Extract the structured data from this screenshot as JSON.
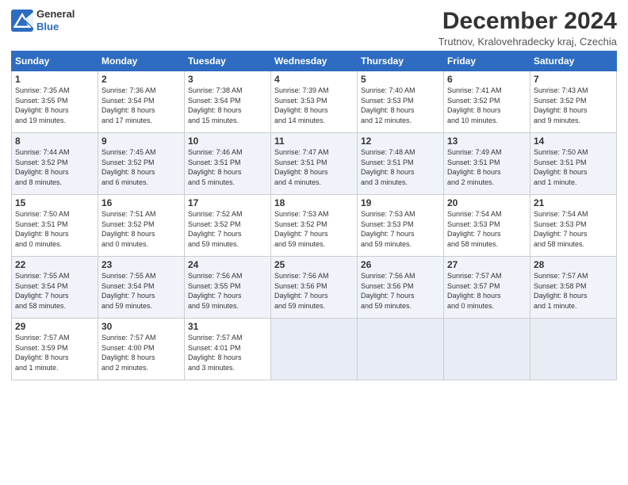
{
  "header": {
    "logo_line1": "General",
    "logo_line2": "Blue",
    "title": "December 2024",
    "location": "Trutnov, Kralovehradecky kraj, Czechia"
  },
  "days_of_week": [
    "Sunday",
    "Monday",
    "Tuesday",
    "Wednesday",
    "Thursday",
    "Friday",
    "Saturday"
  ],
  "weeks": [
    [
      {
        "day": "1",
        "info": "Sunrise: 7:35 AM\nSunset: 3:55 PM\nDaylight: 8 hours\nand 19 minutes."
      },
      {
        "day": "2",
        "info": "Sunrise: 7:36 AM\nSunset: 3:54 PM\nDaylight: 8 hours\nand 17 minutes."
      },
      {
        "day": "3",
        "info": "Sunrise: 7:38 AM\nSunset: 3:54 PM\nDaylight: 8 hours\nand 15 minutes."
      },
      {
        "day": "4",
        "info": "Sunrise: 7:39 AM\nSunset: 3:53 PM\nDaylight: 8 hours\nand 14 minutes."
      },
      {
        "day": "5",
        "info": "Sunrise: 7:40 AM\nSunset: 3:53 PM\nDaylight: 8 hours\nand 12 minutes."
      },
      {
        "day": "6",
        "info": "Sunrise: 7:41 AM\nSunset: 3:52 PM\nDaylight: 8 hours\nand 10 minutes."
      },
      {
        "day": "7",
        "info": "Sunrise: 7:43 AM\nSunset: 3:52 PM\nDaylight: 8 hours\nand 9 minutes."
      }
    ],
    [
      {
        "day": "8",
        "info": "Sunrise: 7:44 AM\nSunset: 3:52 PM\nDaylight: 8 hours\nand 8 minutes."
      },
      {
        "day": "9",
        "info": "Sunrise: 7:45 AM\nSunset: 3:52 PM\nDaylight: 8 hours\nand 6 minutes."
      },
      {
        "day": "10",
        "info": "Sunrise: 7:46 AM\nSunset: 3:51 PM\nDaylight: 8 hours\nand 5 minutes."
      },
      {
        "day": "11",
        "info": "Sunrise: 7:47 AM\nSunset: 3:51 PM\nDaylight: 8 hours\nand 4 minutes."
      },
      {
        "day": "12",
        "info": "Sunrise: 7:48 AM\nSunset: 3:51 PM\nDaylight: 8 hours\nand 3 minutes."
      },
      {
        "day": "13",
        "info": "Sunrise: 7:49 AM\nSunset: 3:51 PM\nDaylight: 8 hours\nand 2 minutes."
      },
      {
        "day": "14",
        "info": "Sunrise: 7:50 AM\nSunset: 3:51 PM\nDaylight: 8 hours\nand 1 minute."
      }
    ],
    [
      {
        "day": "15",
        "info": "Sunrise: 7:50 AM\nSunset: 3:51 PM\nDaylight: 8 hours\nand 0 minutes."
      },
      {
        "day": "16",
        "info": "Sunrise: 7:51 AM\nSunset: 3:52 PM\nDaylight: 8 hours\nand 0 minutes."
      },
      {
        "day": "17",
        "info": "Sunrise: 7:52 AM\nSunset: 3:52 PM\nDaylight: 7 hours\nand 59 minutes."
      },
      {
        "day": "18",
        "info": "Sunrise: 7:53 AM\nSunset: 3:52 PM\nDaylight: 7 hours\nand 59 minutes."
      },
      {
        "day": "19",
        "info": "Sunrise: 7:53 AM\nSunset: 3:53 PM\nDaylight: 7 hours\nand 59 minutes."
      },
      {
        "day": "20",
        "info": "Sunrise: 7:54 AM\nSunset: 3:53 PM\nDaylight: 7 hours\nand 58 minutes."
      },
      {
        "day": "21",
        "info": "Sunrise: 7:54 AM\nSunset: 3:53 PM\nDaylight: 7 hours\nand 58 minutes."
      }
    ],
    [
      {
        "day": "22",
        "info": "Sunrise: 7:55 AM\nSunset: 3:54 PM\nDaylight: 7 hours\nand 58 minutes."
      },
      {
        "day": "23",
        "info": "Sunrise: 7:55 AM\nSunset: 3:54 PM\nDaylight: 7 hours\nand 59 minutes."
      },
      {
        "day": "24",
        "info": "Sunrise: 7:56 AM\nSunset: 3:55 PM\nDaylight: 7 hours\nand 59 minutes."
      },
      {
        "day": "25",
        "info": "Sunrise: 7:56 AM\nSunset: 3:56 PM\nDaylight: 7 hours\nand 59 minutes."
      },
      {
        "day": "26",
        "info": "Sunrise: 7:56 AM\nSunset: 3:56 PM\nDaylight: 7 hours\nand 59 minutes."
      },
      {
        "day": "27",
        "info": "Sunrise: 7:57 AM\nSunset: 3:57 PM\nDaylight: 8 hours\nand 0 minutes."
      },
      {
        "day": "28",
        "info": "Sunrise: 7:57 AM\nSunset: 3:58 PM\nDaylight: 8 hours\nand 1 minute."
      }
    ],
    [
      {
        "day": "29",
        "info": "Sunrise: 7:57 AM\nSunset: 3:59 PM\nDaylight: 8 hours\nand 1 minute."
      },
      {
        "day": "30",
        "info": "Sunrise: 7:57 AM\nSunset: 4:00 PM\nDaylight: 8 hours\nand 2 minutes."
      },
      {
        "day": "31",
        "info": "Sunrise: 7:57 AM\nSunset: 4:01 PM\nDaylight: 8 hours\nand 3 minutes."
      },
      null,
      null,
      null,
      null
    ]
  ]
}
